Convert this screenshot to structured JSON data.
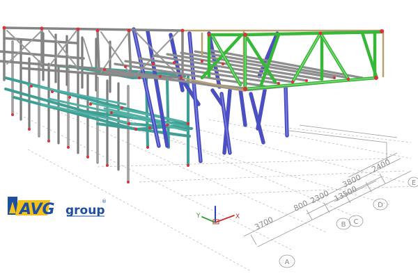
{
  "dimensions": {
    "d1": "3700",
    "d2": "800",
    "d3": "2300",
    "d4": "3800",
    "d5": "13500",
    "d6": "2400"
  },
  "grid_labels": {
    "a": "A",
    "b": "B",
    "c": "C",
    "d": "D",
    "e": "E"
  },
  "axis_labels": {
    "x": "X",
    "y": "Y"
  },
  "logo": {
    "brand": "AVG",
    "suffix": "group",
    "mark": "®"
  },
  "colors": {
    "column": "#4b4fc2",
    "truss": "#38b838",
    "frame": "#3f9f95",
    "joist": "#8a8a8a",
    "node": "#d8323a",
    "dim_line": "#9a9a9a",
    "logo_blue": "#1d4fa3",
    "logo_yellow": "#f2c21a"
  }
}
